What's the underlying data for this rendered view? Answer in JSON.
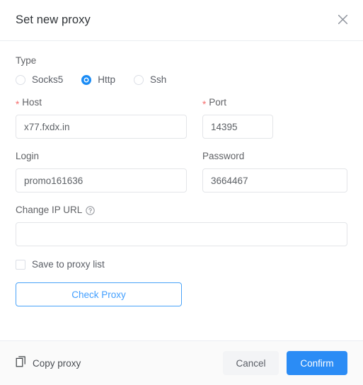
{
  "dialog": {
    "title": "Set new proxy",
    "close_icon": "close-icon"
  },
  "type_field": {
    "label": "Type",
    "options": [
      {
        "label": "Socks5",
        "value": "socks5",
        "checked": false
      },
      {
        "label": "Http",
        "value": "http",
        "checked": true
      },
      {
        "label": "Ssh",
        "value": "ssh",
        "checked": false
      }
    ],
    "selected": "Http"
  },
  "host_field": {
    "label": "Host",
    "required_marker": "*",
    "value": "x77.fxdx.in",
    "placeholder": ""
  },
  "port_field": {
    "label": "Port",
    "required_marker": "*",
    "value": "14395",
    "placeholder": ""
  },
  "login_field": {
    "label": "Login",
    "value": "promo161636",
    "placeholder": ""
  },
  "password_field": {
    "label": "Password",
    "value": "3664467",
    "placeholder": ""
  },
  "change_ip_url_field": {
    "label": "Change IP URL",
    "help_icon": "help-circle-icon",
    "value": "",
    "placeholder": ""
  },
  "save_checkbox": {
    "label": "Save to proxy list",
    "checked": false
  },
  "check_proxy_button": {
    "label": "Check Proxy"
  },
  "footer": {
    "copy_icon": "copy-icon",
    "copy_label": "Copy proxy",
    "cancel_label": "Cancel",
    "confirm_label": "Confirm"
  },
  "colors": {
    "accent_blue": "#2b8cf5",
    "link_blue": "#409eff",
    "required_red": "#f56c6c",
    "border_gray": "#e3e5e8",
    "footer_bg": "#fafafa"
  }
}
